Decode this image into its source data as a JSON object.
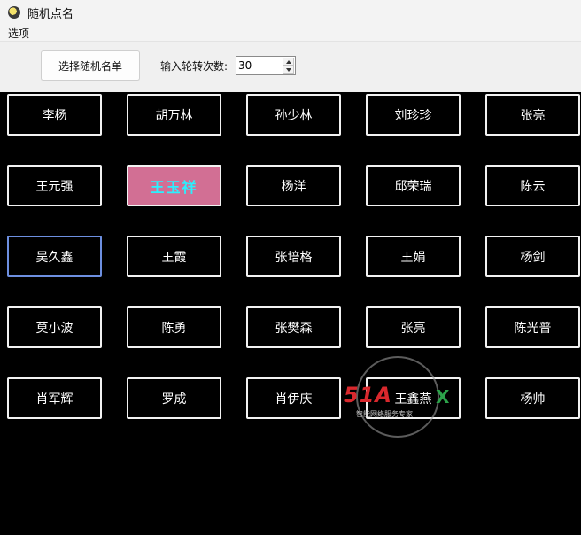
{
  "window": {
    "title": "随机点名"
  },
  "menu": {
    "options_label": "选项"
  },
  "toolbar": {
    "select_list_label": "选择随机名单",
    "rotation_label": "输入轮转次数:",
    "rotation_value": "30"
  },
  "names": [
    [
      "李杨",
      "胡万林",
      "孙少林",
      "刘珍珍",
      "张亮"
    ],
    [
      "王元强",
      "王玉祥",
      "杨洋",
      "邱荣瑞",
      "陈云"
    ],
    [
      "吴久鑫",
      "王霞",
      "张培格",
      "王娟",
      "杨剑"
    ],
    [
      "莫小波",
      "陈勇",
      "张樊森",
      "张亮",
      "陈光普"
    ],
    [
      "肖军辉",
      "罗成",
      "肖伊庆",
      "王鑫燕",
      "杨帅"
    ]
  ],
  "selected": {
    "row": 1,
    "col": 1
  },
  "focused": {
    "row": 2,
    "col": 0
  },
  "colors": {
    "selected_bg": "#d26f94",
    "selected_text": "#29f1ff",
    "card_border": "#f2f2f2",
    "board_bg": "#000000"
  },
  "watermark": {
    "logo": "51",
    "letters": "A",
    "x": "X",
    "sub": "智能网络服务专家"
  }
}
